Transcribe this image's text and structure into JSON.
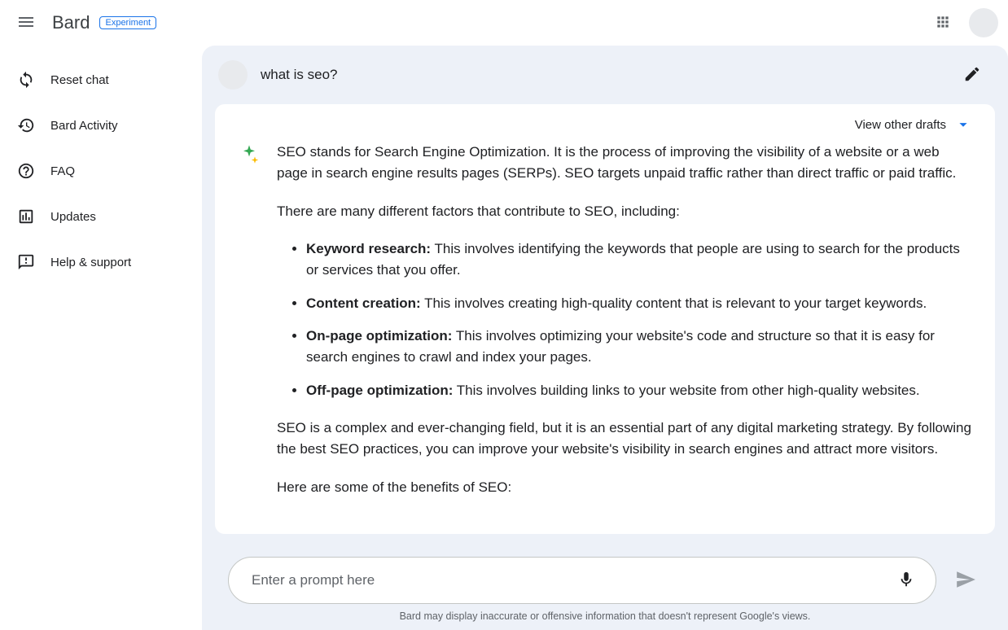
{
  "header": {
    "brand": "Bard",
    "badge": "Experiment"
  },
  "sidebar": {
    "items": [
      {
        "label": "Reset chat"
      },
      {
        "label": "Bard Activity"
      },
      {
        "label": "FAQ"
      },
      {
        "label": "Updates"
      },
      {
        "label": "Help & support"
      }
    ]
  },
  "conversation": {
    "user_prompt": "what is seo?",
    "drafts_label": "View other drafts",
    "response": {
      "intro": "SEO stands for Search Engine Optimization. It is the process of improving the visibility of a website or a web page in search engine results pages (SERPs). SEO targets unpaid traffic rather than direct traffic or paid traffic.",
      "factors_intro": "There are many different factors that contribute to SEO, including:",
      "factors": [
        {
          "term": "Keyword research:",
          "desc": " This involves identifying the keywords that people are using to search for the products or services that you offer."
        },
        {
          "term": "Content creation:",
          "desc": " This involves creating high-quality content that is relevant to your target keywords."
        },
        {
          "term": "On-page optimization:",
          "desc": " This involves optimizing your website's code and structure so that it is easy for search engines to crawl and index your pages."
        },
        {
          "term": "Off-page optimization:",
          "desc": " This involves building links to your website from other high-quality websites."
        }
      ],
      "conclusion": "SEO is a complex and ever-changing field, but it is an essential part of any digital marketing strategy. By following the best SEO practices, you can improve your website's visibility in search engines and attract more visitors.",
      "benefits_intro": "Here are some of the benefits of SEO:"
    }
  },
  "composer": {
    "placeholder": "Enter a prompt here"
  },
  "footer": {
    "disclaimer": "Bard may display inaccurate or offensive information that doesn't represent Google's views."
  }
}
